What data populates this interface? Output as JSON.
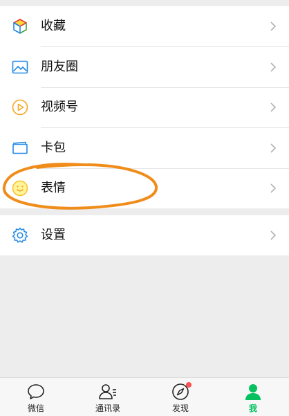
{
  "menu": {
    "group1": [
      {
        "label": "收藏",
        "icon": "favorites-cube-icon"
      },
      {
        "label": "朋友圈",
        "icon": "moments-picture-icon"
      },
      {
        "label": "视频号",
        "icon": "channels-play-icon"
      },
      {
        "label": "卡包",
        "icon": "card-wallet-icon"
      },
      {
        "label": "表情",
        "icon": "sticker-smile-icon"
      }
    ],
    "group2": [
      {
        "label": "设置",
        "icon": "settings-gear-icon"
      }
    ]
  },
  "tabbar": {
    "items": [
      {
        "label": "微信",
        "icon": "chat-bubble-icon",
        "active": false
      },
      {
        "label": "通讯录",
        "icon": "contacts-icon",
        "active": false
      },
      {
        "label": "发现",
        "icon": "compass-icon",
        "active": false,
        "badge_dot": true
      },
      {
        "label": "我",
        "icon": "me-person-icon",
        "active": true
      }
    ]
  },
  "colors": {
    "accent_green": "#07c160",
    "badge_red": "#fa5151",
    "annotation_orange": "#f08c1a",
    "background": "#ededed"
  }
}
